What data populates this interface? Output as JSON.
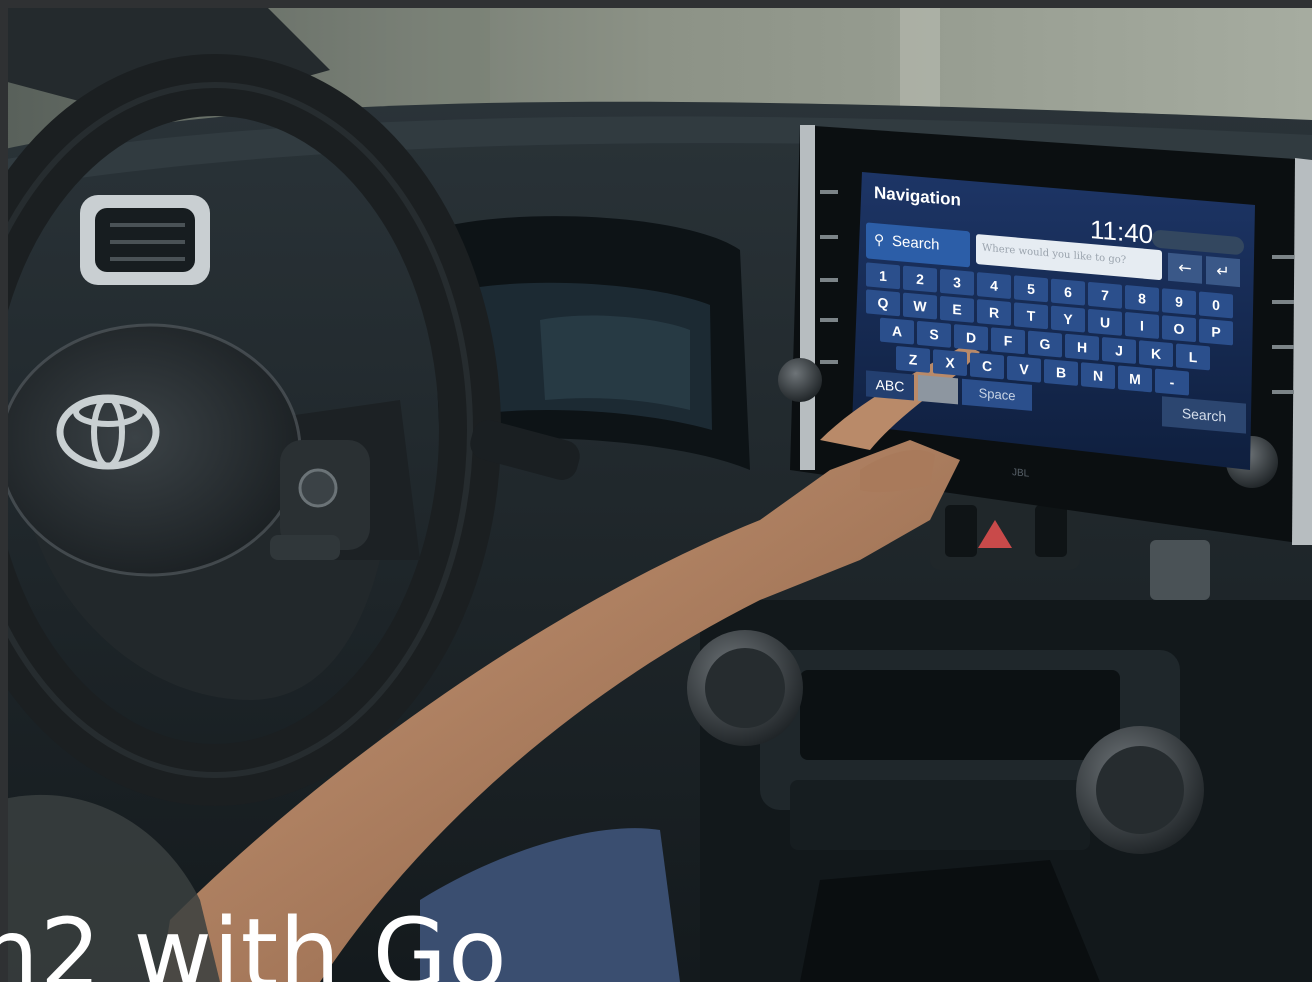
{
  "caption": "n2 with Go",
  "infotainment": {
    "title": "Navigation",
    "clock": "11:40",
    "search_tab": "Search",
    "search_placeholder": "Where would you like to go?",
    "keyboard_rows": [
      [
        "1",
        "2",
        "3",
        "4",
        "5",
        "6",
        "7",
        "8",
        "9",
        "0"
      ],
      [
        "Q",
        "W",
        "E",
        "R",
        "T",
        "Y",
        "U",
        "I",
        "O",
        "P"
      ],
      [
        "A",
        "S",
        "D",
        "F",
        "G",
        "H",
        "J",
        "K",
        "L"
      ],
      [
        "Z",
        "X",
        "C",
        "V",
        "B",
        "N",
        "M",
        "-"
      ]
    ],
    "abc_key": "ABC",
    "space_key": "Space",
    "search_button": "Search",
    "back_icon": "back-arrow-icon",
    "return_icon": "return-icon"
  },
  "scene": {
    "brand_badge": "toyota-emblem",
    "speaker_brand": "JBL"
  },
  "colors": {
    "screen_bg": "#1e3a6b",
    "key_bg": "#2b4f8c",
    "dashboard": "#1b2226",
    "background_trees": "#6f7a68"
  }
}
